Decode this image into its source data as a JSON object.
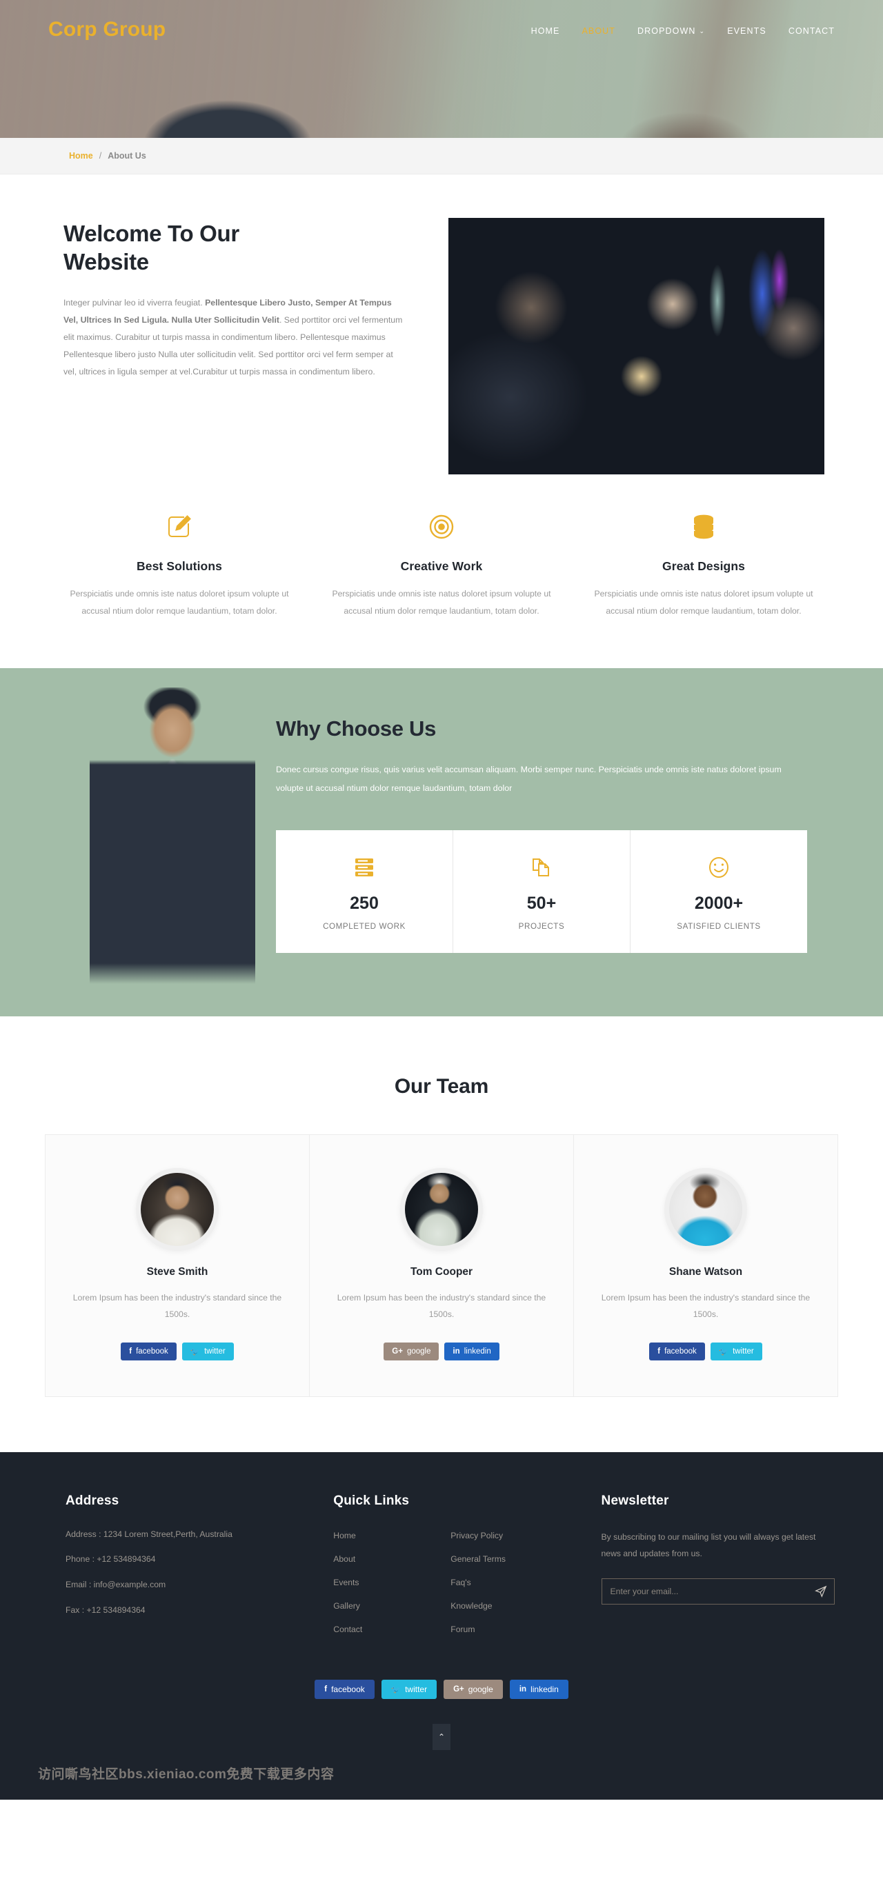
{
  "header": {
    "brand": "Corp Group",
    "nav": [
      {
        "label": "HOME",
        "active": false,
        "caret": ""
      },
      {
        "label": "ABOUT",
        "active": true,
        "caret": ""
      },
      {
        "label": "DROPDOWN",
        "active": false,
        "caret": "⌄"
      },
      {
        "label": "EVENTS",
        "active": false,
        "caret": ""
      },
      {
        "label": "CONTACT",
        "active": false,
        "caret": ""
      }
    ]
  },
  "breadcrumb": {
    "home": "Home",
    "separator": "/",
    "current": "About Us"
  },
  "welcome": {
    "title": "Welcome To Our Website",
    "para_lead": "Integer pulvinar leo id viverra feugiat. ",
    "para_bold": "Pellentesque Libero Justo, Semper At Tempus Vel, Ultrices In Sed Ligula. Nulla Uter Sollicitudin Velit",
    "para_rest": ". Sed porttitor orci vel fermentum elit maximus. Curabitur ut turpis massa in condimentum libero. Pellentesque maximus Pellentesque libero justo Nulla uter sollicitudin velit. Sed porttitor orci vel ferm semper at vel, ultrices in ligula semper at vel.Curabitur ut turpis massa in condimentum libero."
  },
  "features": [
    {
      "icon": "pencil-square-icon",
      "title": "Best Solutions",
      "text": "Perspiciatis unde omnis iste natus doloret ipsum volupte ut accusal ntium dolor remque laudantium, totam dolor."
    },
    {
      "icon": "target-icon",
      "title": "Creative Work",
      "text": "Perspiciatis unde omnis iste natus doloret ipsum volupte ut accusal ntium dolor remque laudantium, totam dolor."
    },
    {
      "icon": "coins-stack-icon",
      "title": "Great Designs",
      "text": "Perspiciatis unde omnis iste natus doloret ipsum volupte ut accusal ntium dolor remque laudantium, totam dolor."
    }
  ],
  "why": {
    "title": "Why Choose Us",
    "text": "Donec cursus congue risus, quis varius velit accumsan aliquam. Morbi semper nunc. Perspiciatis unde omnis iste natus doloret ipsum volupte ut accusal ntium dolor remque laudantium, totam dolor",
    "counters": [
      {
        "icon": "server-icon",
        "number": "250",
        "label": "COMPLETED WORK"
      },
      {
        "icon": "copy-files-icon",
        "number": "50+",
        "label": "PROJECTS"
      },
      {
        "icon": "smiley-face-icon",
        "number": "2000+",
        "label": "SATISFIED CLIENTS"
      }
    ]
  },
  "team": {
    "title": "Our Team",
    "members": [
      {
        "name": "Steve Smith",
        "desc": "Lorem Ipsum has been the industry's standard since the 1500s.",
        "socials": [
          {
            "network": "facebook",
            "label": "facebook",
            "icon": "f"
          },
          {
            "network": "twitter",
            "label": "twitter",
            "icon": "🐦"
          }
        ]
      },
      {
        "name": "Tom Cooper",
        "desc": "Lorem Ipsum has been the industry's standard since the 1500s.",
        "socials": [
          {
            "network": "google",
            "label": "google",
            "icon": "G+"
          },
          {
            "network": "linkedin",
            "label": "linkedin",
            "icon": "in"
          }
        ]
      },
      {
        "name": "Shane Watson",
        "desc": "Lorem Ipsum has been the industry's standard since the 1500s.",
        "socials": [
          {
            "network": "facebook",
            "label": "facebook",
            "icon": "f"
          },
          {
            "network": "twitter",
            "label": "twitter",
            "icon": "🐦"
          }
        ]
      }
    ]
  },
  "footer": {
    "address": {
      "title": "Address",
      "lines": [
        "Address : 1234 Lorem Street,Perth, Australia",
        "Phone : +12 534894364",
        "Email : info@example.com",
        "Fax : +12 534894364"
      ]
    },
    "quick_links": {
      "title": "Quick Links",
      "col1": [
        "Home",
        "About",
        "Events",
        "Gallery",
        "Contact"
      ],
      "col2": [
        "Privacy Policy",
        "General Terms",
        "Faq's",
        "Knowledge",
        "Forum"
      ]
    },
    "newsletter": {
      "title": "Newsletter",
      "text": "By subscribing to our mailing list you will always get latest news and updates from us.",
      "placeholder": "Enter your email...",
      "value": "",
      "send_icon": "paper-plane-icon"
    },
    "socials": [
      {
        "network": "facebook",
        "label": "facebook",
        "icon": "f"
      },
      {
        "network": "twitter",
        "label": "twitter",
        "icon": "🐦"
      },
      {
        "network": "google",
        "label": "google",
        "icon": "G+"
      },
      {
        "network": "linkedin",
        "label": "linkedin",
        "icon": "in"
      }
    ],
    "to_top": "⌃",
    "watermark": "访问嘶鸟社区bbs.xieniao.com免费下载更多内容"
  },
  "colors": {
    "accent": "#eab12d",
    "dark": "#22272e",
    "footer_bg": "#1d232c",
    "why_bg": "#a3bda8"
  }
}
